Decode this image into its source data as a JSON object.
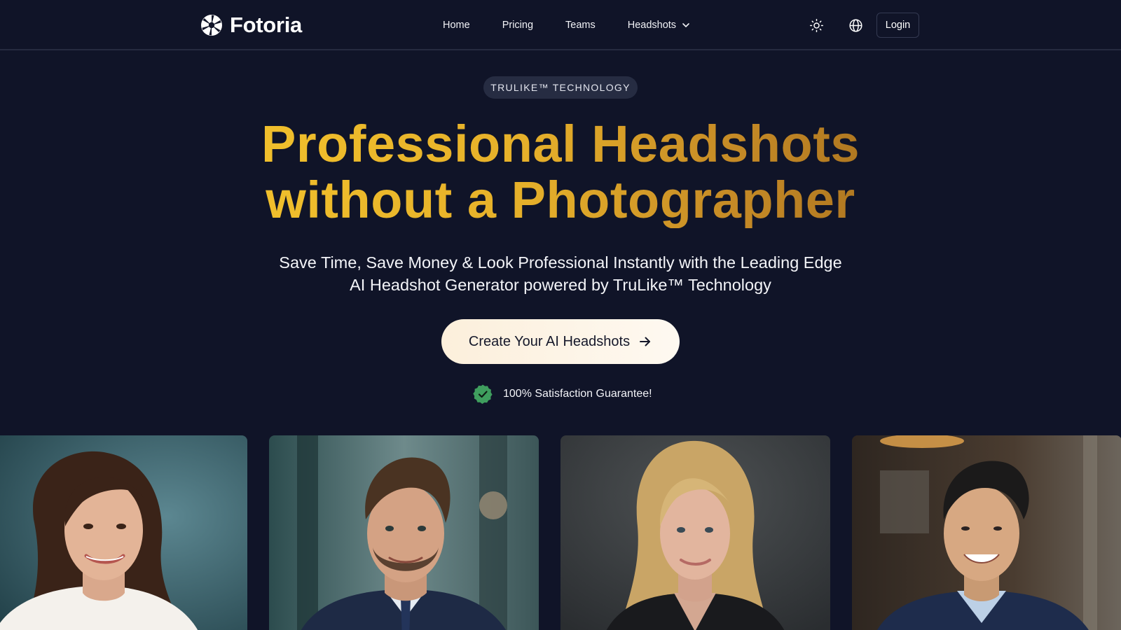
{
  "header": {
    "brand": "Fotoria",
    "logo_icon": "aperture-icon",
    "nav": [
      {
        "label": "Home"
      },
      {
        "label": "Pricing"
      },
      {
        "label": "Teams"
      },
      {
        "label": "Headshots",
        "has_dropdown": true
      }
    ],
    "theme_toggle_icon": "sun-icon",
    "language_icon": "globe-icon",
    "login_label": "Login"
  },
  "hero": {
    "badge": "TRULIKE™ TECHNOLOGY",
    "headline_line1": "Professional Headshots",
    "headline_line2": "without a Photographer",
    "subtitle_line1": "Save Time, Save Money & Look Professional Instantly with the Leading Edge",
    "subtitle_line2": "AI Headshot Generator powered by TruLike™ Technology",
    "cta_label": "Create Your AI Headshots",
    "cta_icon": "arrow-right-icon",
    "guarantee_icon": "check-badge-icon",
    "guarantee_text": "100% Satisfaction Guarantee!"
  },
  "gallery": {
    "items": [
      {
        "subject": "woman-white-blouse"
      },
      {
        "subject": "man-navy-suit"
      },
      {
        "subject": "woman-black-blazer"
      },
      {
        "subject": "man-navy-blazer"
      }
    ]
  },
  "colors": {
    "background": "#101428",
    "headline_gradient_start": "#f2c22c",
    "headline_gradient_end": "#a8711f",
    "cta_background": "#fdf3e3",
    "guarantee_green": "#3f9e5e",
    "badge_background": "#262c42"
  }
}
